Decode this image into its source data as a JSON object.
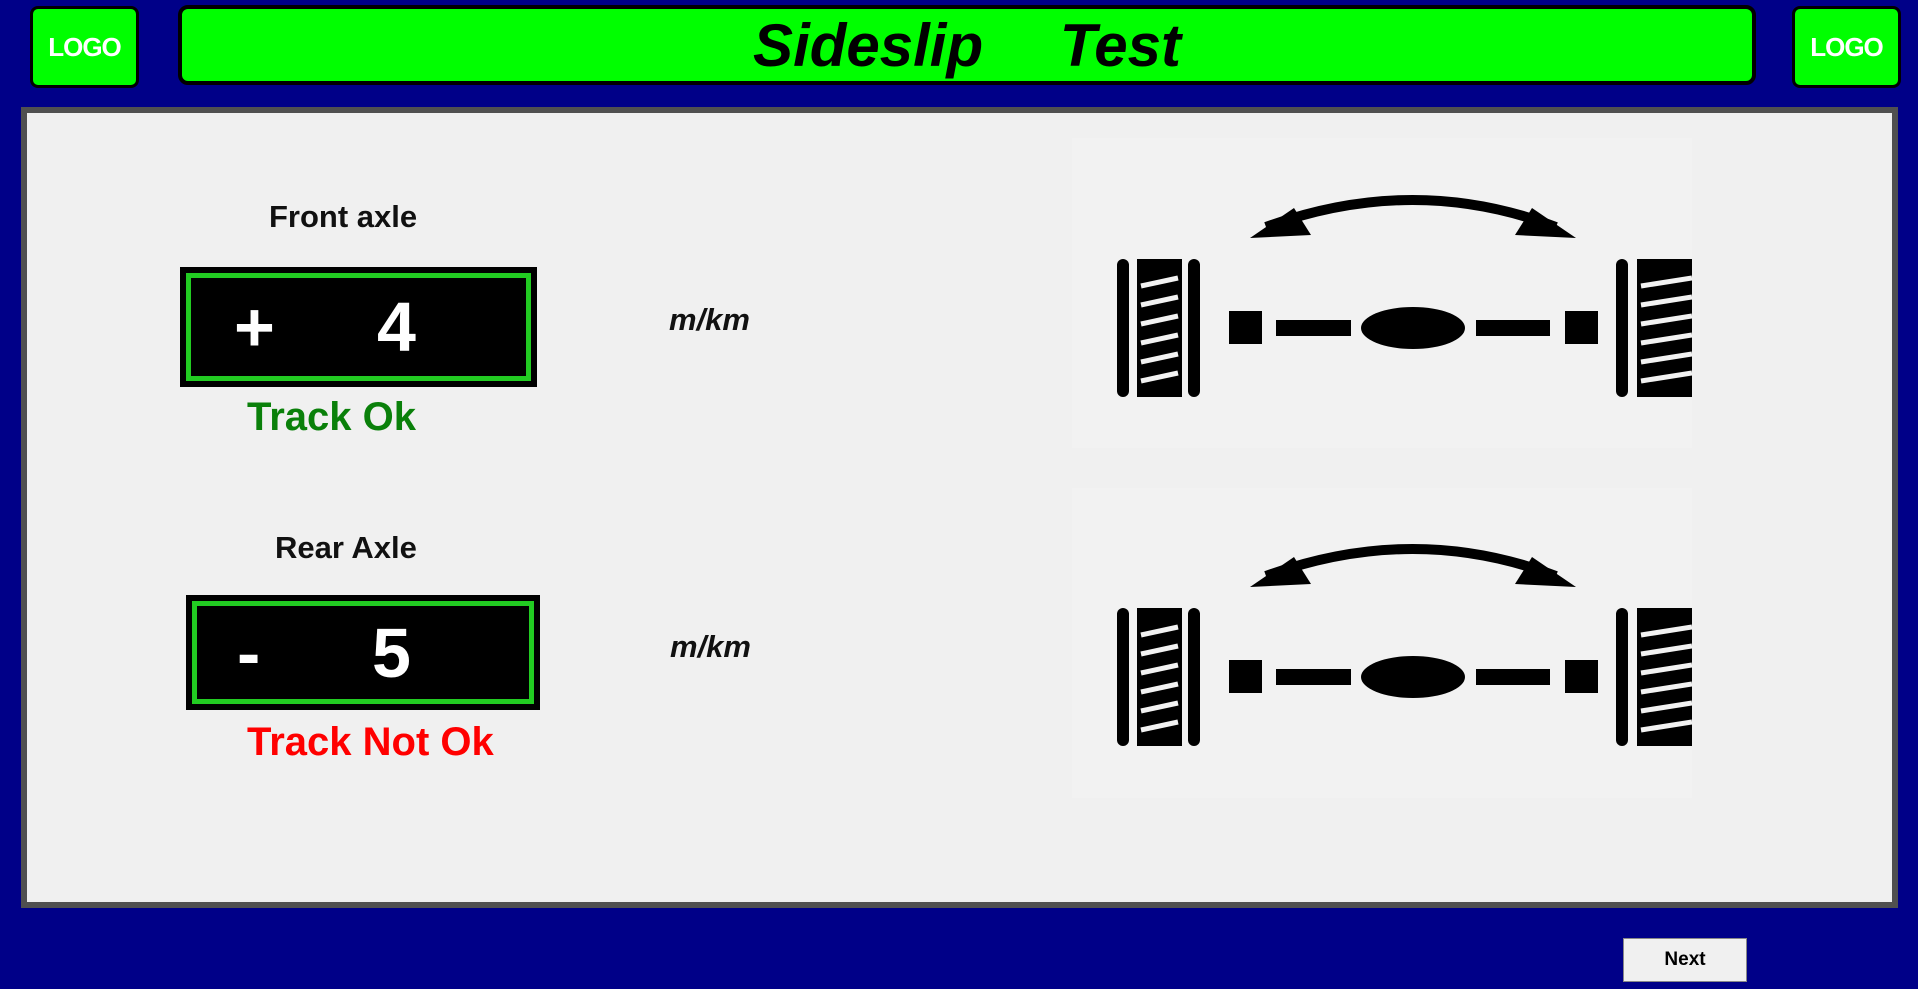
{
  "header": {
    "title": "Sideslip     Test",
    "logo_left": "LOGO",
    "logo_right": "LOGO"
  },
  "front_axle": {
    "label": "Front axle",
    "sign": "+",
    "value": "4",
    "unit": "m/km",
    "status": "Track Ok",
    "status_color": "#0a800a"
  },
  "rear_axle": {
    "label": "Rear Axle",
    "sign": "-",
    "value": "5",
    "unit": "m/km",
    "status": "Track Not Ok",
    "status_color": "#ff0000"
  },
  "footer": {
    "next_label": "Next"
  },
  "colors": {
    "background": "#000088",
    "accent": "#00ff00",
    "panel": "#f0f0f0",
    "display_border": "#22cc22"
  },
  "icons": {
    "axle": "axle-diagram-icon",
    "arrow": "double-arrow-icon"
  }
}
